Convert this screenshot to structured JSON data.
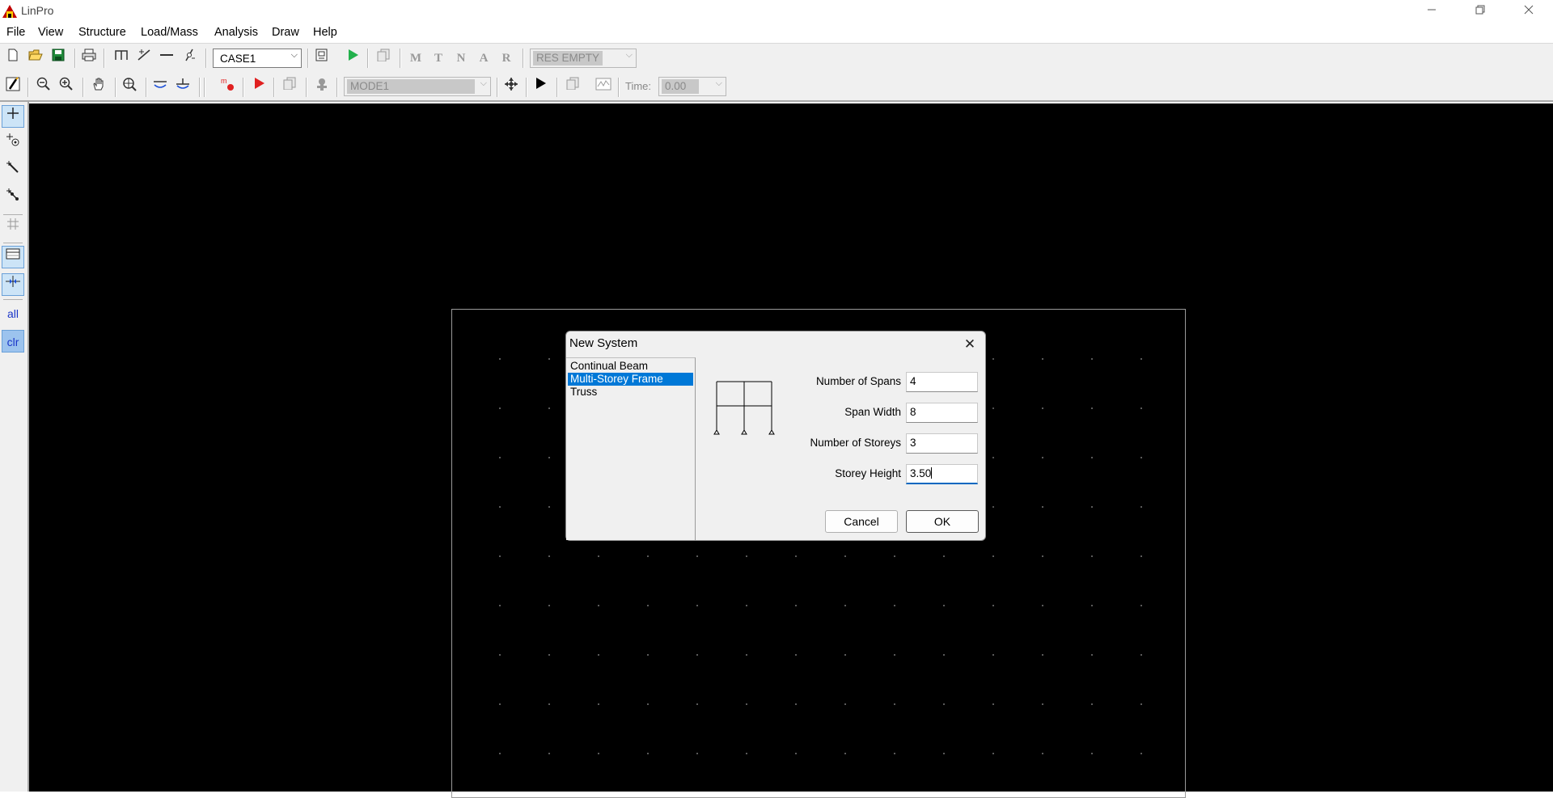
{
  "window": {
    "title": "LinPro",
    "controls": [
      "minimize",
      "restore",
      "close"
    ]
  },
  "menu": [
    "File",
    "View",
    "Structure",
    "Load/Mass",
    "Analysis",
    "Draw",
    "Help"
  ],
  "toolbar1": {
    "case_select": "CASE1",
    "results_select": "RES EMPTY",
    "disabled_letters": [
      "M",
      "T",
      "N",
      "A",
      "R"
    ]
  },
  "toolbar2": {
    "mode_select": "MODE1",
    "time_label": "Time:",
    "time_select": "0.00"
  },
  "left_toolbar": {
    "all_label": "all",
    "clr_label": "clr"
  },
  "dialog": {
    "title": "New System",
    "close_glyph": "✕",
    "system_types": [
      "Continual Beam",
      "Multi-Storey Frame",
      "Truss"
    ],
    "selected_type": "Multi-Storey Frame",
    "fields": [
      {
        "label": "Number of Spans",
        "value": "4"
      },
      {
        "label": "Span Width",
        "value": "8"
      },
      {
        "label": "Number of Storeys",
        "value": "3"
      },
      {
        "label": "Storey Height",
        "value": "3.50"
      }
    ],
    "cancel_label": "Cancel",
    "ok_label": "OK"
  },
  "colors": {
    "canvas": "#000000",
    "selection": "#0078d7",
    "run_green": "#22b14c",
    "run_red": "#e02020"
  }
}
